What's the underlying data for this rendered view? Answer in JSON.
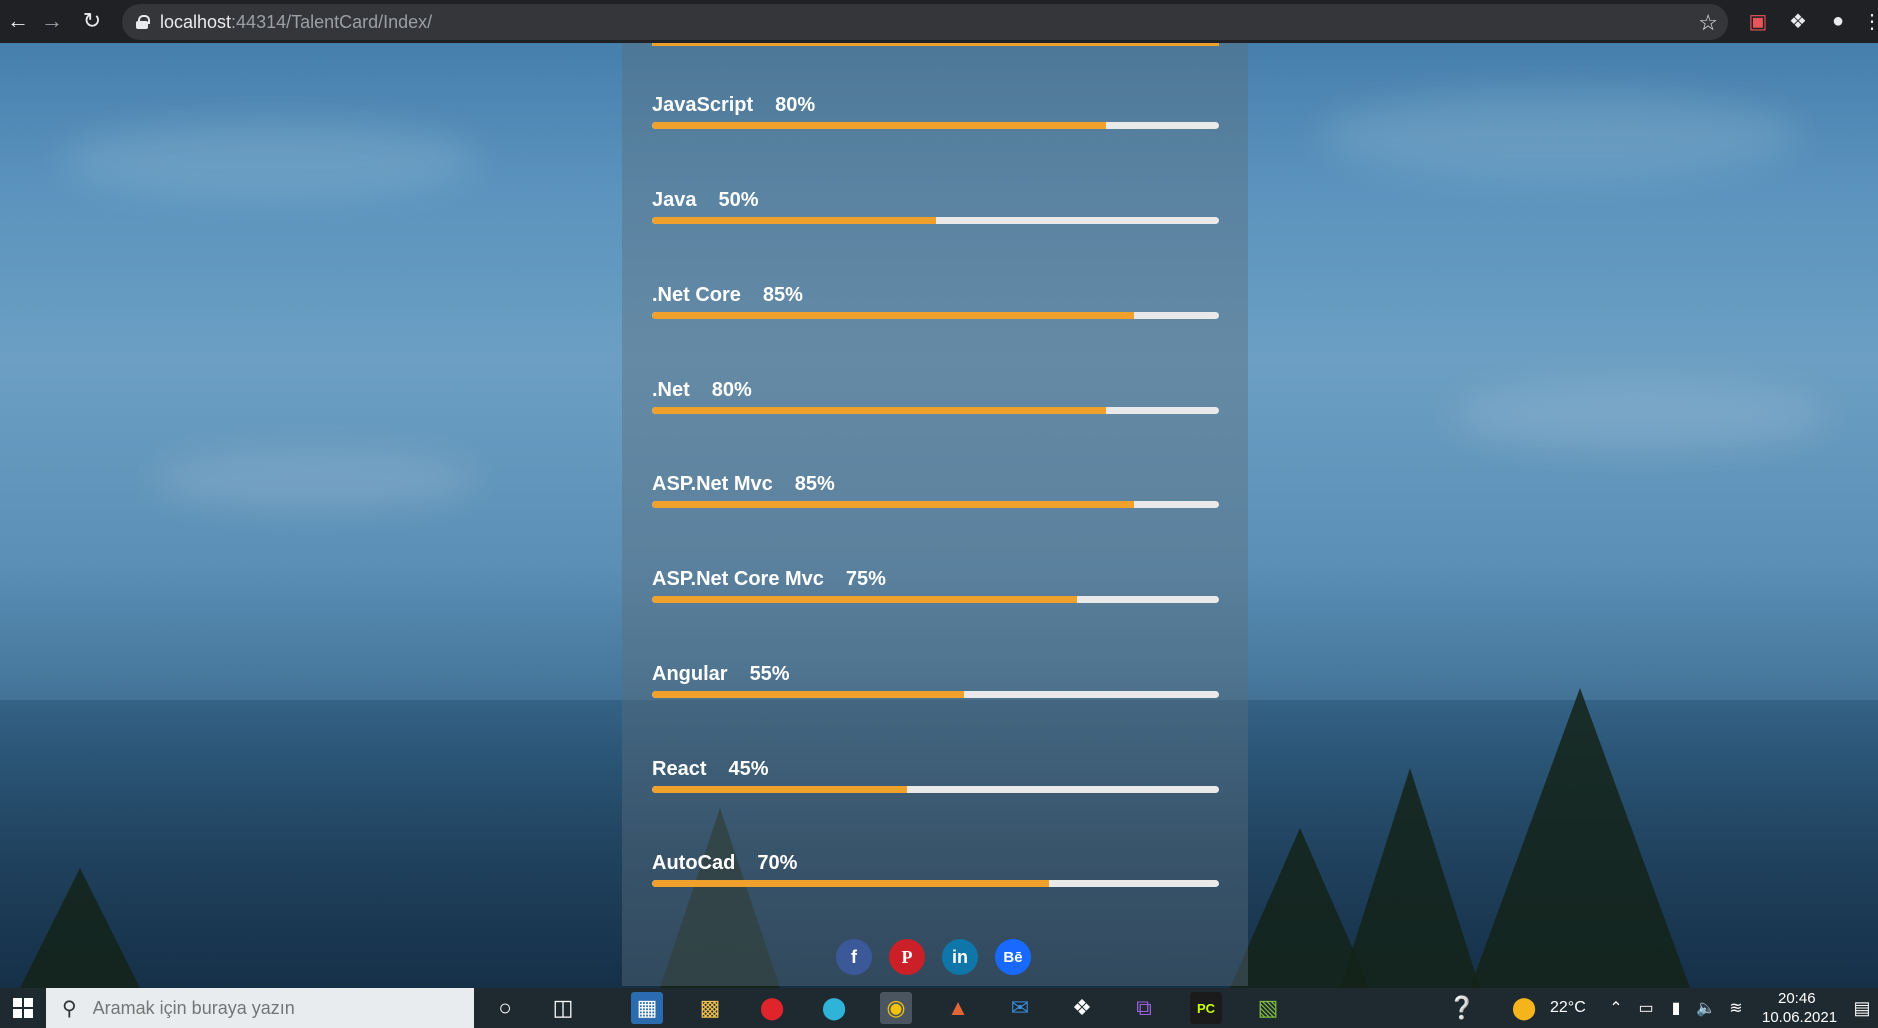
{
  "browser": {
    "url_host": "localhost",
    "url_path": ":44314/TalentCard/Index/"
  },
  "skills": [
    {
      "name": "JavaScript",
      "percent_label": "80%",
      "value": 80
    },
    {
      "name": "Java",
      "percent_label": "50%",
      "value": 50
    },
    {
      "name": ".Net Core",
      "percent_label": "85%",
      "value": 85
    },
    {
      "name": ".Net",
      "percent_label": "80%",
      "value": 80
    },
    {
      "name": "ASP.Net Mvc",
      "percent_label": "85%",
      "value": 85
    },
    {
      "name": "ASP.Net Core Mvc",
      "percent_label": "75%",
      "value": 75
    },
    {
      "name": "Angular",
      "percent_label": "55%",
      "value": 55
    },
    {
      "name": "React",
      "percent_label": "45%",
      "value": 45
    },
    {
      "name": "AutoCad",
      "percent_label": "70%",
      "value": 70
    }
  ],
  "social": [
    {
      "name": "facebook-icon",
      "label": "f",
      "color": "#3b5998"
    },
    {
      "name": "pinterest-icon",
      "label": "P",
      "color": "#cb2027"
    },
    {
      "name": "linkedin-icon",
      "label": "in",
      "color": "#0e76a8"
    },
    {
      "name": "behance-icon",
      "label": "Bē",
      "color": "#1769ff"
    }
  ],
  "colors": {
    "accent": "#f0a12b",
    "track": "#e9e9e9"
  },
  "taskbar": {
    "search_placeholder": "Aramak için buraya yazın",
    "weather": "22°C",
    "time": "20:46",
    "date": "10.06.2021"
  }
}
